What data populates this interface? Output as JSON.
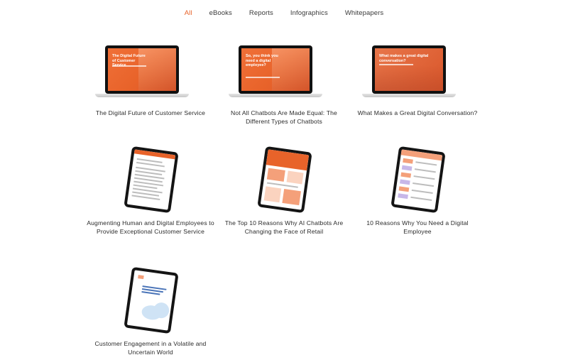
{
  "filters": [
    {
      "label": "All",
      "active": true
    },
    {
      "label": "eBooks",
      "active": false
    },
    {
      "label": "Reports",
      "active": false
    },
    {
      "label": "Infographics",
      "active": false
    },
    {
      "label": "Whitepapers",
      "active": false
    }
  ],
  "cards": [
    {
      "title": "The Digital Future of Customer Service",
      "screen_text": "The Digital Future of Customer Service"
    },
    {
      "title": "Not All Chatbots Are Made Equal: The Different Types of Chatbots",
      "screen_text": "So, you think you need a digital employee?"
    },
    {
      "title": "What Makes a Great Digital Conversation?",
      "screen_text": "What makes a great digital conversation?"
    },
    {
      "title": "Augmenting Human and Digital Employees to Provide Exceptional Customer Service"
    },
    {
      "title": "The Top 10 Reasons Why AI Chatbots Are Changing the Face of Retail"
    },
    {
      "title": "10 Reasons Why You Need a Digital Employee"
    },
    {
      "title": "Customer Engagement in a Volatile and Uncertain World"
    }
  ],
  "colors": {
    "accent": "#e8632a",
    "text": "#2b2b2b"
  }
}
